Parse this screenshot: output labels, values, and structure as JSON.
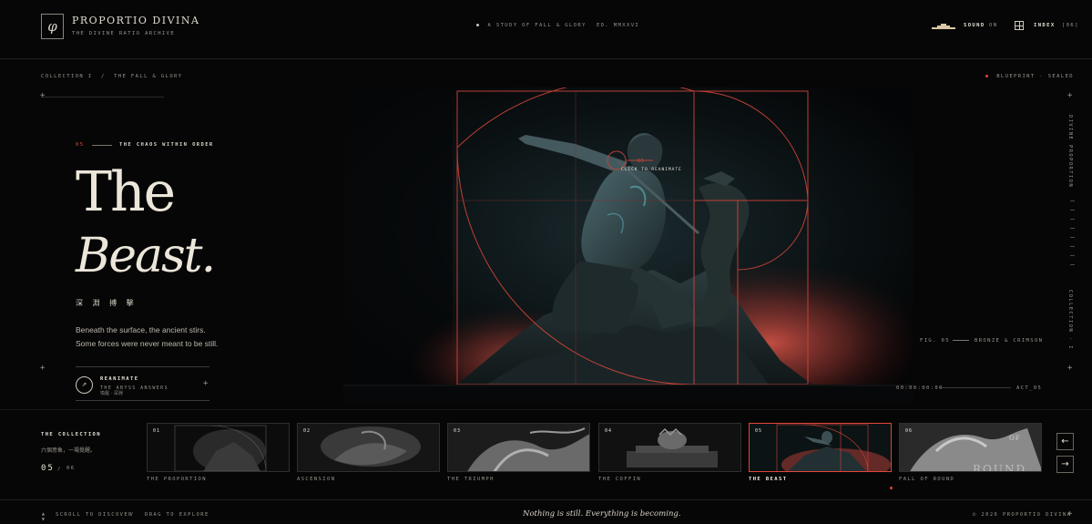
{
  "header": {
    "logo_glyph": "φ",
    "brand": "PROPORTIO DIVINA",
    "brand_sub": "THE DIVINE RATIO ARCHIVE",
    "study": "A STUDY OF FALL & GLORY",
    "edition": "ED. MMXXVI",
    "sound_label": "SOUND",
    "sound_state": "ON",
    "index_label": "INDEX",
    "index_count": "[06]"
  },
  "breadcrumb": "COLLECTION I  /  THE FALL & GLORY",
  "blueprint": "BLUEPRINT · SEALED",
  "hero": {
    "section_num": "05",
    "section_title": "THE CHAOS WITHIN ORDER",
    "title_line1": "The",
    "title_line2": "Beast.",
    "cjk_sub": "深 淵 搏 擊",
    "desc_line1": "Beneath the surface, the ancient stirs.",
    "desc_line2": "Some forces were never meant to be still.",
    "cta_label": "REANIMATE",
    "cta_sub": "THE ABYSS ANSWERS",
    "cta_cjk": "喚醒 · 深淵",
    "cta_icon": "arrow-icon",
    "annotation_num": "05",
    "annotation_text": "CLICK TO REANIMATE",
    "fig_label": "FIG. 05",
    "fig_desc": "BRONZE & CRIMSON",
    "timecode": "00:00:00:00",
    "act_label": "ACT_05",
    "rail_top": "DIVINE PROPORTION",
    "rail_bottom": "COLLECTION · I"
  },
  "accent_color": "#e0463a",
  "collection": {
    "title": "THE COLLECTION",
    "subtitle": "六個意象，一場覺醒。",
    "current": "05",
    "separator": "/",
    "total": "06",
    "items": [
      {
        "num": "01",
        "label": "THE PROPORTION"
      },
      {
        "num": "02",
        "label": "ASCENSION"
      },
      {
        "num": "03",
        "label": "THE TRIUMPH"
      },
      {
        "num": "04",
        "label": "THE COFFIN"
      },
      {
        "num": "05",
        "label": "THE BEAST"
      },
      {
        "num": "06",
        "label": "FALL OF ROUND"
      }
    ],
    "prev_icon": "←",
    "next_icon": "→"
  },
  "footer": {
    "scroll_label": "SCROLL TO DISCOVER",
    "separator": "/",
    "drag_label": "DRAG TO EXPLORE",
    "tagline": "Nothing is still. Everything is becoming.",
    "copyright": "© 2026 PROPORTIO DIVINA"
  }
}
